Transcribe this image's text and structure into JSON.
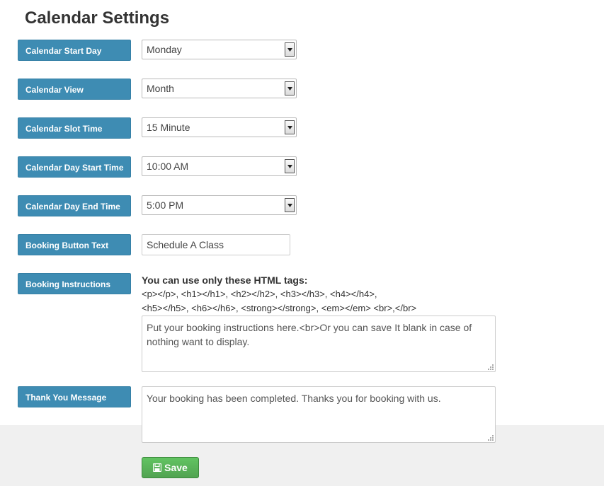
{
  "page": {
    "title": "Calendar Settings"
  },
  "fields": {
    "start_day": {
      "label": "Calendar Start Day",
      "value": "Monday"
    },
    "view": {
      "label": "Calendar View",
      "value": "Month"
    },
    "slot_time": {
      "label": "Calendar Slot Time",
      "value": "15 Minute"
    },
    "day_start": {
      "label": "Calendar Day Start Time",
      "value": "10:00 AM"
    },
    "day_end": {
      "label": "Calendar Day End Time",
      "value": "5:00 PM"
    },
    "button_text": {
      "label": "Booking Button Text",
      "value": "Schedule A Class"
    },
    "instructions": {
      "label": "Booking Instructions",
      "tags_heading": "You can use only these HTML tags:",
      "tags_line1": "<p></p>, <h1></h1>, <h2></h2>, <h3></h3>, <h4></h4>,",
      "tags_line2": "<h5></h5>, <h6></h6>, <strong></strong>, <em></em> <br>,</br>",
      "value": "Put your booking instructions here.<br>Or you can save It blank in case of nothing want to display."
    },
    "thank_you": {
      "label": "Thank You Message",
      "value": "Your booking has been completed. Thanks you for booking with us."
    }
  },
  "actions": {
    "save_label": "Save",
    "save_icon": "save-icon"
  },
  "colors": {
    "label_bg": "#3e8cb3",
    "save_bg": "#5bb75b",
    "footer_bg": "#f0f0f0"
  }
}
